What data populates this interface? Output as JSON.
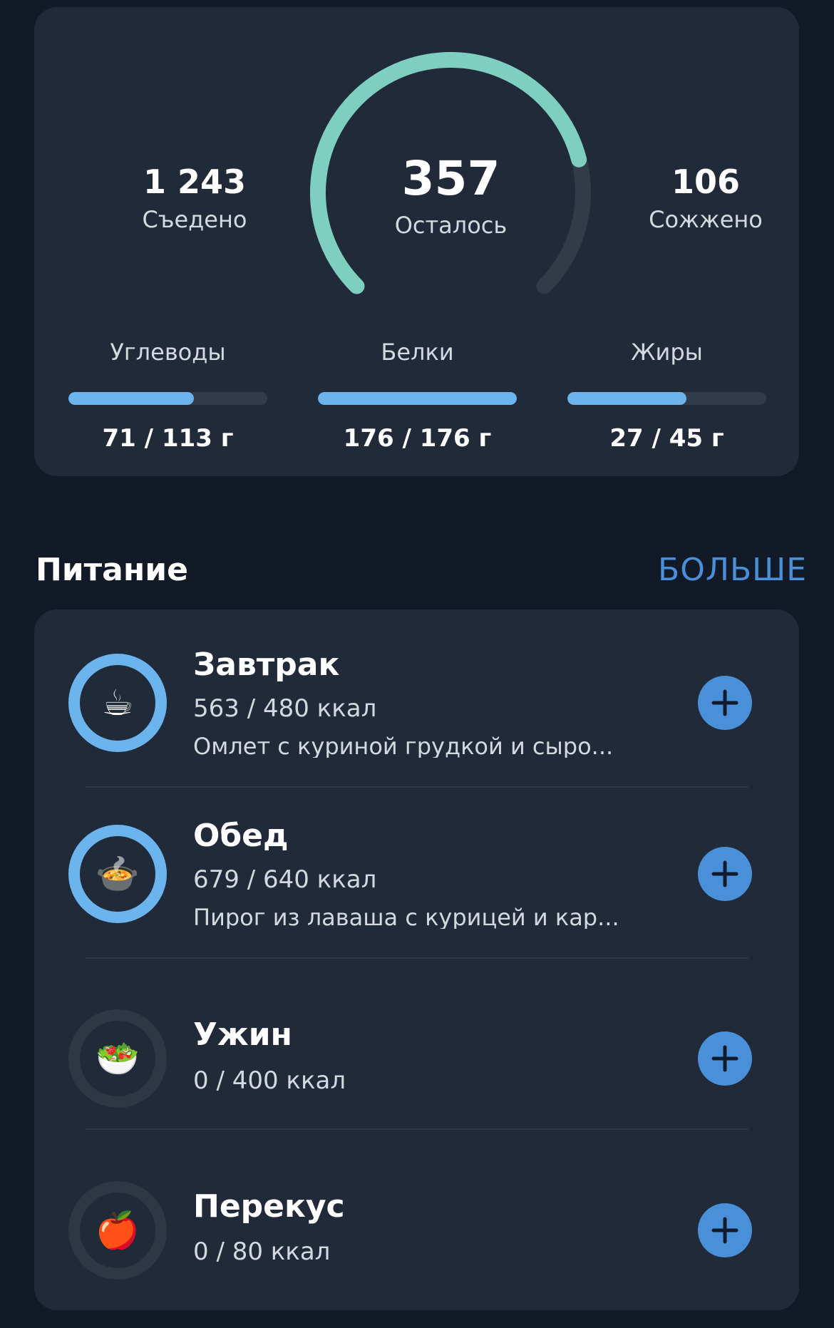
{
  "summary": {
    "eaten": {
      "value": "1 243",
      "label": "Съедено"
    },
    "remaining": {
      "value": "357",
      "label": "Осталось",
      "progress": 0.78
    },
    "burned": {
      "value": "106",
      "label": "Сожжено"
    }
  },
  "macros": [
    {
      "label": "Углеводы",
      "amount": "71 / 113 г",
      "progress": 0.63
    },
    {
      "label": "Белки",
      "amount": "176 / 176 г",
      "progress": 1.0
    },
    {
      "label": "Жиры",
      "amount": "27 / 45 г",
      "progress": 0.6
    }
  ],
  "nutrition": {
    "title": "Питание",
    "more": "БОЛЬШЕ"
  },
  "meals": [
    {
      "name": "Завтрак",
      "kcal": "563 / 480 ккал",
      "desc": "Омлет с куриной грудкой и сыро...",
      "icon": "coffee-cup-icon",
      "emoji": "☕",
      "active": true
    },
    {
      "name": "Обед",
      "kcal": "679 / 640 ккал",
      "desc": "Пирог из лаваша с курицей и кар...",
      "icon": "soup-bowl-icon",
      "emoji": "🍲",
      "active": true
    },
    {
      "name": "Ужин",
      "kcal": "0 / 400 ккал",
      "desc": "",
      "icon": "salad-icon",
      "emoji": "🥗",
      "active": false
    },
    {
      "name": "Перекус",
      "kcal": "0 / 80 ккал",
      "desc": "",
      "icon": "apple-icon",
      "emoji": "🍎",
      "active": false
    }
  ],
  "colors": {
    "background": "#131a27",
    "card": "#212a38",
    "gauge": "#7fcfc0",
    "gauge_track": "#323b48",
    "macro_fill": "#6cb4ee",
    "accent": "#4a90d9"
  }
}
